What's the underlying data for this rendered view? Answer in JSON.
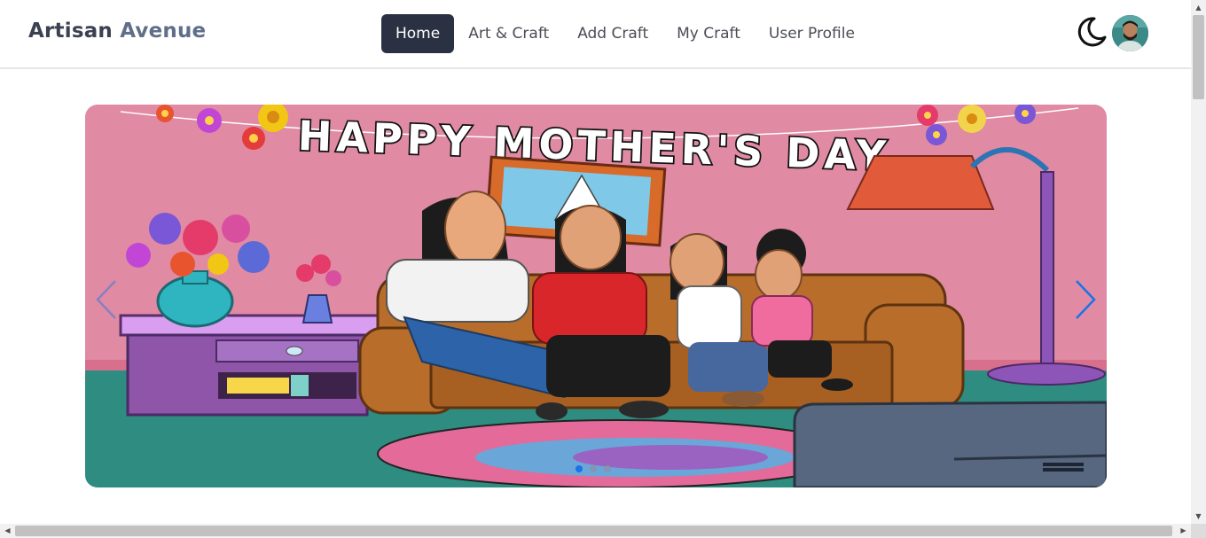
{
  "brand": {
    "part1": "Artisan",
    "part2": "Avenue"
  },
  "nav": {
    "items": [
      {
        "label": "Home",
        "active": true
      },
      {
        "label": "Art & Craft",
        "active": false
      },
      {
        "label": "Add Craft",
        "active": false
      },
      {
        "label": "My Craft",
        "active": false
      },
      {
        "label": "User Profile",
        "active": false
      }
    ]
  },
  "header_actions": {
    "theme_icon": "moon-icon",
    "avatar_icon": "user-avatar"
  },
  "carousel": {
    "banner_text": "HAPPY MOTHER'S DAY",
    "slide_count": 3,
    "active_slide": 1,
    "prev_icon": "chevron-left-icon",
    "next_icon": "chevron-right-icon"
  },
  "colors": {
    "active_nav_bg": "#2a3142",
    "wall": "#e08aa3",
    "floor": "#2e8c80",
    "arrow": "#1a73e8"
  }
}
